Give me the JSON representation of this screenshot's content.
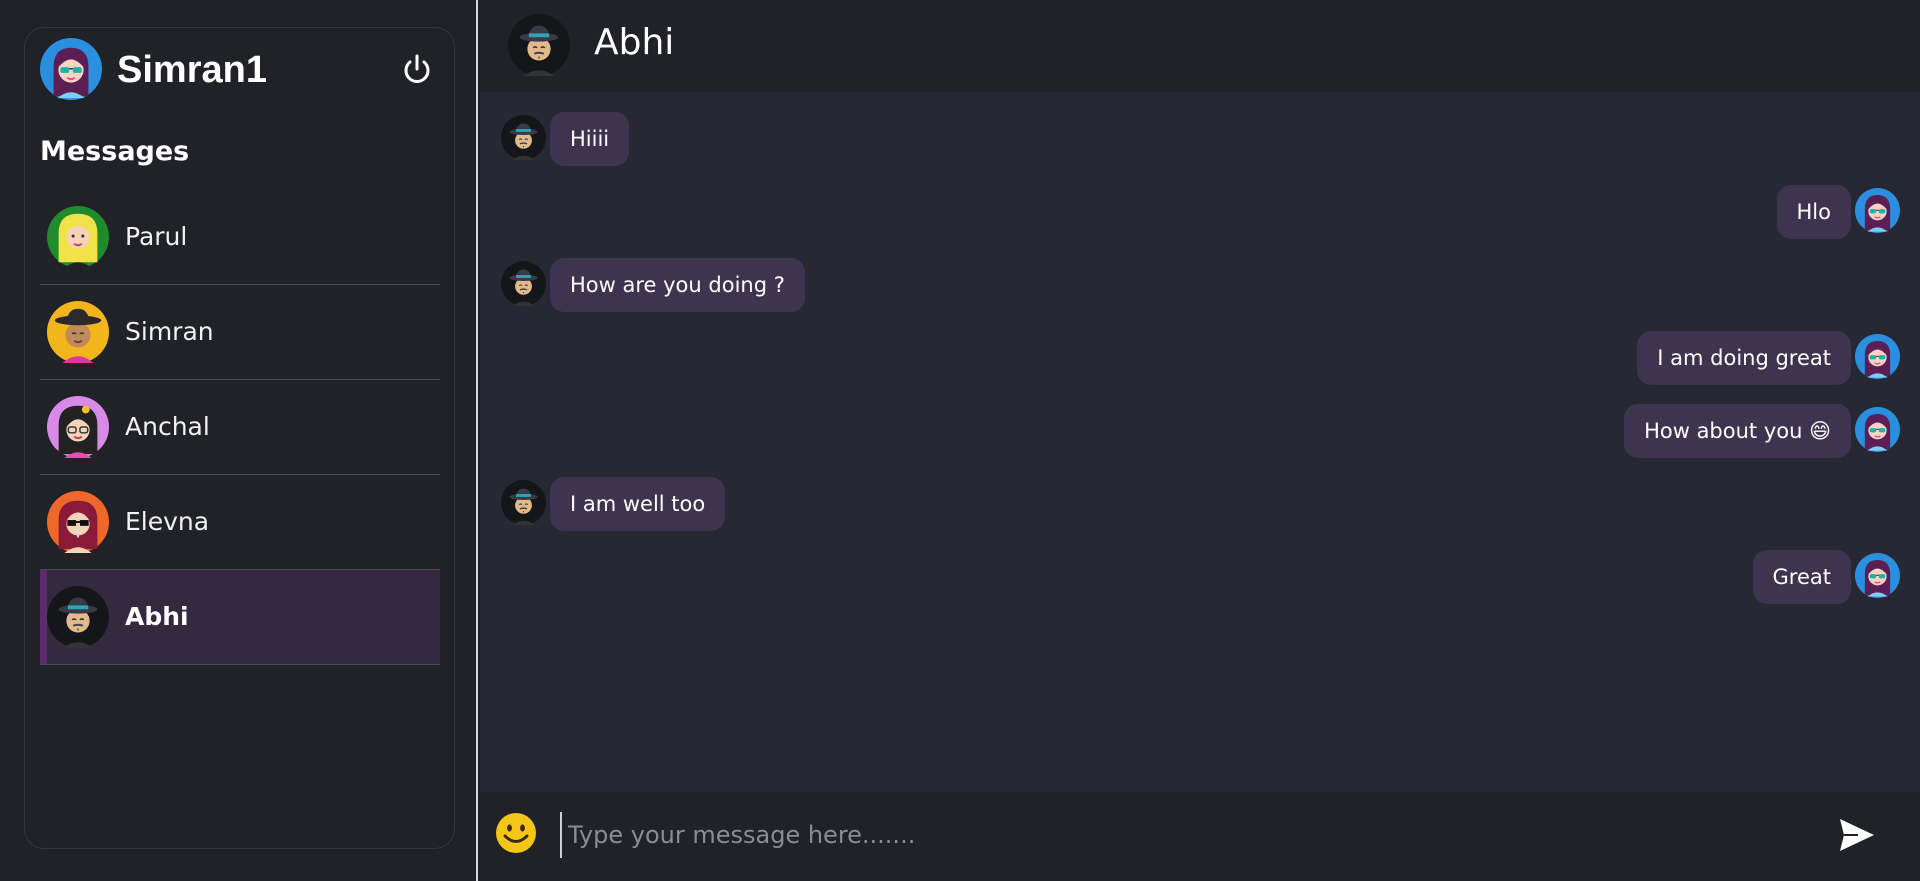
{
  "user": {
    "name": "Simran1",
    "avatar_icon": "woman-sunglasses-avatar"
  },
  "sidebar": {
    "title": "Messages",
    "power_icon": "power-icon",
    "contacts": [
      {
        "name": "Parul",
        "avatar_icon": "blonde-woman-avatar",
        "active": false
      },
      {
        "name": "Simran",
        "avatar_icon": "hat-woman-avatar",
        "active": false
      },
      {
        "name": "Anchal",
        "avatar_icon": "glasses-flower-avatar",
        "active": false
      },
      {
        "name": "Elevna",
        "avatar_icon": "red-hair-sunglasses-avatar",
        "active": false
      },
      {
        "name": "Abhi",
        "avatar_icon": "fedora-man-avatar",
        "active": true
      }
    ]
  },
  "chat": {
    "contact_name": "Abhi",
    "messages": [
      {
        "direction": "in",
        "text": "Hiiii"
      },
      {
        "direction": "out",
        "text": "Hlo"
      },
      {
        "direction": "in",
        "text": "How are you doing ?"
      },
      {
        "direction": "out",
        "text": "I am doing great"
      },
      {
        "direction": "out",
        "text": "How about you 😄"
      },
      {
        "direction": "in",
        "text": "I am well too"
      },
      {
        "direction": "out",
        "text": "Great"
      }
    ]
  },
  "composer": {
    "placeholder": "Type your message here.......",
    "value": "",
    "emoji_icon": "smiley-icon",
    "send_icon": "send-icon"
  },
  "colors": {
    "background": "#202228",
    "chat_background": "#262833",
    "bubble": "#3e3450",
    "active_contact": "#35293f",
    "active_accent": "#5a2c6a"
  }
}
